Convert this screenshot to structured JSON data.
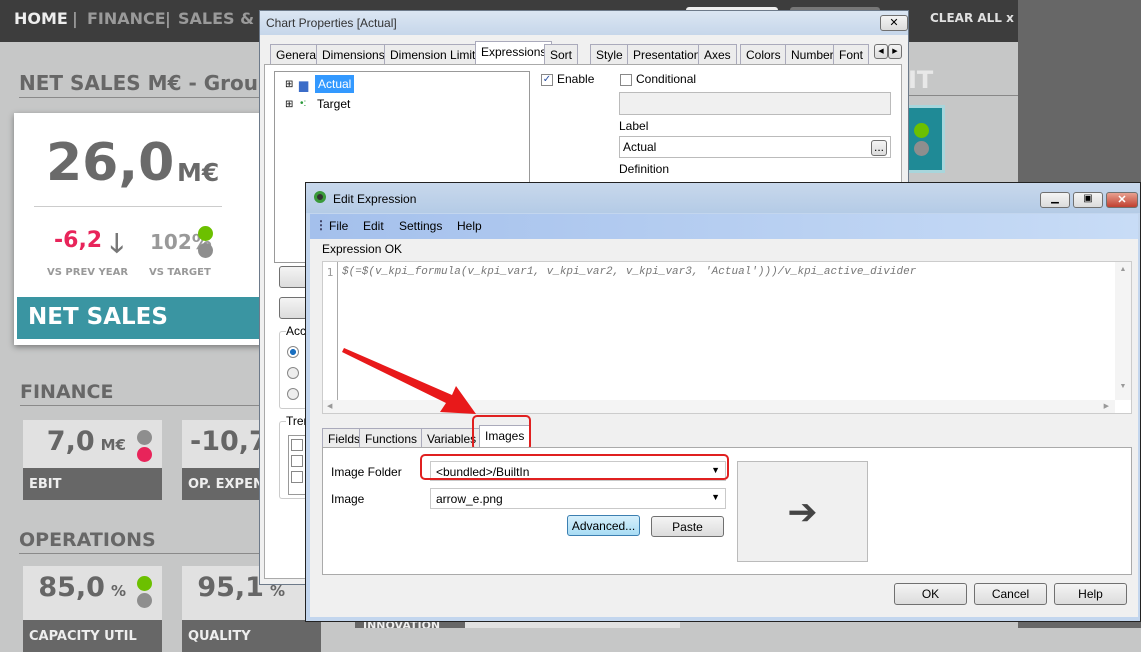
{
  "nav": {
    "items": [
      "HOME",
      "FINANCE",
      "SALES & M"
    ],
    "clear_all": "CLEAR ALL",
    "clear_x": "x"
  },
  "dashboard": {
    "title": "NET SALES M€ - Grou",
    "title_right": "IT",
    "main_kpi": {
      "value": "26,0",
      "unit": "M€",
      "delta": "-6,2",
      "delta_label": "VS PREV YEAR",
      "pct": "102%",
      "pct_label": "VS TARGET",
      "footer": "NET SALES"
    },
    "finance": {
      "heading": "FINANCE",
      "cards": [
        {
          "value": "7,0",
          "unit": "M€",
          "label": "EBIT"
        },
        {
          "value": "-10,7",
          "unit": "",
          "label": "OP. EXPEN"
        }
      ]
    },
    "operations": {
      "heading": "OPERATIONS",
      "cards": [
        {
          "value": "85,0",
          "unit": "%",
          "label": "CAPACITY UTIL"
        },
        {
          "value": "95,1",
          "unit": "%",
          "label": "QUALITY"
        },
        {
          "value": "",
          "unit": "",
          "label": "INNOVATION IND"
        }
      ]
    },
    "colors": {
      "green": "#6cc000",
      "gray": "#8e8e8e",
      "red": "#e8245a",
      "teal": "#3a95a2"
    }
  },
  "chart_props": {
    "title": "Chart Properties [Actual]",
    "tabs": [
      "General",
      "Dimensions",
      "Dimension Limits",
      "Expressions",
      "Sort",
      "Style",
      "Presentation",
      "Axes",
      "Colors",
      "Number",
      "Font"
    ],
    "tree": [
      "Actual",
      "Target"
    ],
    "enable": "Enable",
    "conditional": "Conditional",
    "label_caption": "Label",
    "label_value": "Actual",
    "definition": "Definition",
    "ellipsis": "...",
    "group_acc": "Acc",
    "group_trend": "Tren"
  },
  "edit_expr": {
    "title": "Edit Expression",
    "menu": [
      "File",
      "Edit",
      "Settings",
      "Help"
    ],
    "status": "Expression OK",
    "line_no": "1",
    "code": "$(=$(v_kpi_formula(v_kpi_var1, v_kpi_var2, v_kpi_var3, 'Actual')))/v_kpi_active_divider",
    "tabs": [
      "Fields",
      "Functions",
      "Variables",
      "Images"
    ],
    "image_folder_label": "Image Folder",
    "image_folder": "<bundled>/BuiltIn",
    "image_label": "Image",
    "image": "arrow_e.png",
    "advanced": "Advanced...",
    "paste": "Paste",
    "ok": "OK",
    "cancel": "Cancel",
    "help": "Help"
  }
}
